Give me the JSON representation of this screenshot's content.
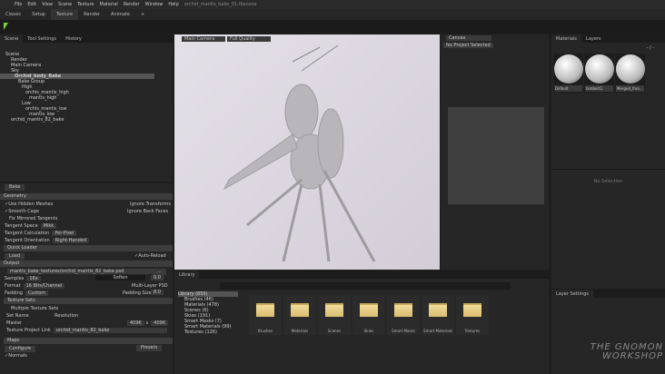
{
  "menu": {
    "items": [
      "File",
      "Edit",
      "View",
      "Scene",
      "Texture",
      "Material",
      "Render",
      "Window",
      "Help"
    ],
    "title": "orchid_mantis_bake_01.tbscene"
  },
  "modes": [
    "Classic",
    "Setup",
    "Texture",
    "Render",
    "Animate",
    "+"
  ],
  "scene_panel": {
    "tabs": [
      "Scene",
      "Tool Settings",
      "History"
    ],
    "tree": [
      "Scene",
      "Render",
      "Main Camera",
      "Sky",
      "Orchid_body_Bake",
      "Bake Group",
      "High",
      "orchis_mantis_high",
      "mantis_high",
      "Low",
      "orchis_mantis_low",
      "mantis_low",
      "orchid_mantis_82_bake"
    ]
  },
  "bake": {
    "button": "Bake",
    "geometry": "Geometry",
    "use_hidden": "Use Hidden Meshes",
    "ignore_transforms": "Ignore Transforms",
    "smooth_cage": "Smooth Cage",
    "ignore_back": "Ignore Back Faces",
    "fix_mirrored": "Fix Mirrored Tangents",
    "tangent_space_label": "Tangent Space",
    "tangent_space": "Mikk",
    "tangent_calc_label": "Tangent Calculation",
    "tangent_calc": "Per-Pixel",
    "tangent_orient_label": "Tangent Orientation",
    "tangent_orient": "Right-Handed",
    "quick_loader": "Quick Loader",
    "load": "Load",
    "auto_reload": "Auto-Reload",
    "output": "Output",
    "output_path": "mantis_bake_textures/orchid_mantis_82_bake.psd",
    "browse": "...",
    "samples_label": "Samples",
    "samples": "16x",
    "soften_label": "Soften",
    "soften": "0.0",
    "format_label": "Format",
    "format": "16 Bits/Channel",
    "multi_layer": "Multi-Layer PSD",
    "padding_label": "Padding",
    "padding": "Custom",
    "padding_size_label": "Padding Size",
    "padding_size": "8.0",
    "texture_sets": "Texture Sets",
    "multiple_sets": "Multiple Texture Sets",
    "set_name": "Set Name",
    "resolution": "Resolution",
    "master": "Master",
    "res_w": "4096",
    "res_x": "x",
    "res_h": "4096",
    "project_link_label": "Texture Project Link",
    "project_link": "orchid_mantis_82_bake",
    "maps": "Maps",
    "configure": "Configure",
    "presets": "Presets",
    "normals": "Normals"
  },
  "viewport": {
    "camera": "Main Camera",
    "quality": "Full Quality"
  },
  "canvas": {
    "title": "Canvas",
    "project": "No Project Selected"
  },
  "materials": {
    "tabs": [
      "Materials",
      "Layers"
    ],
    "counter": "- / -",
    "items": [
      "Default",
      "lambert1",
      "Merged_fron..."
    ],
    "no_selection": "No Selection"
  },
  "layer_settings": {
    "title": "Layer Settings"
  },
  "library": {
    "title": "Library",
    "tree": [
      "Library (855)",
      "Brushes (46)",
      "Materials (478)",
      "Scenes (6)",
      "Skies (191)",
      "Smart Masks (7)",
      "Smart Materials (99)",
      "Textures (126)"
    ],
    "folders": [
      "Brushes",
      "Materials",
      "Scenes",
      "Skies",
      "Smart Masks",
      "Smart Materials",
      "Textures"
    ]
  },
  "watermark": "THE GNOMON WORKSHOP"
}
